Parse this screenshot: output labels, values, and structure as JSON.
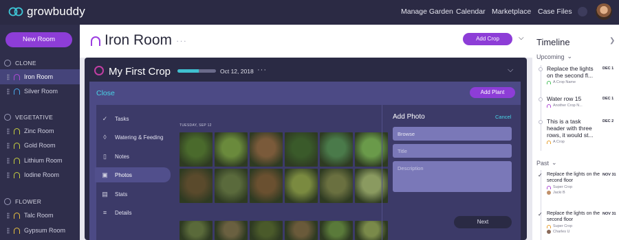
{
  "app": {
    "name": "growbuddy"
  },
  "nav": {
    "links": [
      "Manage Garden",
      "Calendar",
      "Marketplace",
      "Case Files"
    ]
  },
  "sidebar": {
    "new_room_label": "New Room",
    "sections": [
      {
        "label": "CLONE",
        "rooms": [
          "Iron Room",
          "Silver Room"
        ]
      },
      {
        "label": "VEGETATIVE",
        "rooms": [
          "Zinc Room",
          "Gold Room",
          "Lithium Room",
          "Iodine Room"
        ]
      },
      {
        "label": "FLOWER",
        "rooms": [
          "Talc Room",
          "Gypsum Room"
        ]
      }
    ],
    "active_room": "Iron Room",
    "room_colors": {
      "Iron Room": "#b04ad8",
      "Silver Room": "#4aa8e8",
      "Zinc Room": "#c8d040",
      "Gold Room": "#c8d040",
      "Lithium Room": "#c8d040",
      "Iodine Room": "#c8d040",
      "Talc Room": "#e8c040",
      "Gypsum Room": "#e8c040"
    }
  },
  "header": {
    "room_title": "Iron Room",
    "more_label": "···",
    "add_crop_label": "Add Crop"
  },
  "crop": {
    "title": "My First Crop",
    "date": "Oct 12, 2018",
    "progress": 0.55,
    "more_label": "···"
  },
  "panel": {
    "close_label": "Close",
    "add_plant_label": "Add Plant",
    "menu": [
      {
        "label": "Tasks",
        "icon": "check-icon"
      },
      {
        "label": "Watering & Feeding",
        "icon": "droplet-icon"
      },
      {
        "label": "Notes",
        "icon": "note-icon"
      },
      {
        "label": "Photos",
        "icon": "photo-icon"
      },
      {
        "label": "Stats",
        "icon": "stats-icon"
      },
      {
        "label": "Details",
        "icon": "list-icon"
      }
    ],
    "active_menu": "Photos",
    "photo_date": "TUESDAY, SEP 12",
    "photo_colors": [
      "#4a6a2c",
      "#6a8a3c",
      "#7a5a3a",
      "#3a5a2a",
      "#4a7a4a",
      "#6a9a4a",
      "#5a4a2c",
      "#5a6a3c",
      "#6a5030",
      "#7a8a40",
      "#6a7040",
      "#8a9a60"
    ],
    "photo_colors_row2": [
      "#5a6a3a",
      "#6a6040",
      "#4a5a2a",
      "#6a5a3a",
      "#5a7a3a",
      "#7a8a4a"
    ]
  },
  "add_photo": {
    "title": "Add Photo",
    "cancel_label": "Cancel",
    "browse_label": "Browse",
    "title_placeholder": "Title",
    "description_placeholder": "Description",
    "next_label": "Next"
  },
  "timeline": {
    "title": "Timeline",
    "upcoming_label": "Upcoming",
    "past_label": "Past",
    "upcoming": [
      {
        "head": "Replace the lights on the second fl...",
        "sub": "A Crop Name",
        "date": "DEC 1",
        "color": "#4cc060"
      },
      {
        "head": "Water row 15",
        "sub": "Another Crop N...",
        "date": "DEC 1",
        "color": "#b04ad8"
      },
      {
        "head": "This is a task header with three rows, it would st...",
        "sub": "A Crop",
        "date": "DEC 2",
        "color": "#e8a030"
      }
    ],
    "past": [
      {
        "head": "Replace the lights on the second floor",
        "sub": "Super Crop",
        "user": "Jacki B",
        "date": "NOV 31",
        "color": "#b04ad8"
      },
      {
        "head": "Replace the lights on the second floor",
        "sub": "Super Crop",
        "user": "Charles U",
        "date": "NOV 31",
        "color": "#e8a030"
      }
    ]
  }
}
